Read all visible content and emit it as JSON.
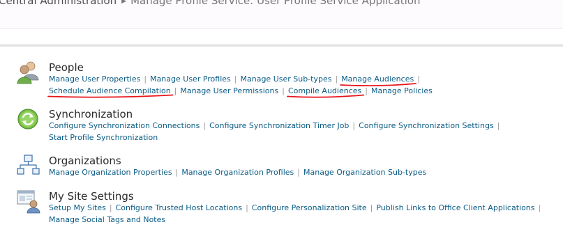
{
  "breadcrumb": {
    "root": "Central Administration",
    "current": "Manage Profile Service: User Profile Service Application"
  },
  "groups": [
    {
      "title": "People",
      "icon": "people-icon",
      "links": [
        "Manage User Properties",
        "Manage User Profiles",
        "Manage User Sub-types",
        "Manage Audiences",
        "Schedule Audience Compilation",
        "Manage User Permissions",
        "Compile Audiences",
        "Manage Policies"
      ]
    },
    {
      "title": "Synchronization",
      "icon": "sync-icon",
      "links": [
        "Configure Synchronization Connections",
        "Configure Synchronization Timer Job",
        "Configure Synchronization Settings",
        "Start Profile Synchronization"
      ]
    },
    {
      "title": "Organizations",
      "icon": "org-chart-icon",
      "links": [
        "Manage Organization Properties",
        "Manage Organization Profiles",
        "Manage Organization Sub-types"
      ]
    },
    {
      "title": "My Site Settings",
      "icon": "my-site-icon",
      "links": [
        "Setup My Sites",
        "Configure Trusted Host Locations",
        "Configure Personalization Site",
        "Publish Links to Office Client Applications",
        "Manage Social Tags and Notes"
      ]
    }
  ],
  "annotations": {
    "underlined_links": [
      "Manage Audiences",
      "Schedule Audience Compilation",
      "Compile Audiences"
    ],
    "color": "#e8141c"
  }
}
